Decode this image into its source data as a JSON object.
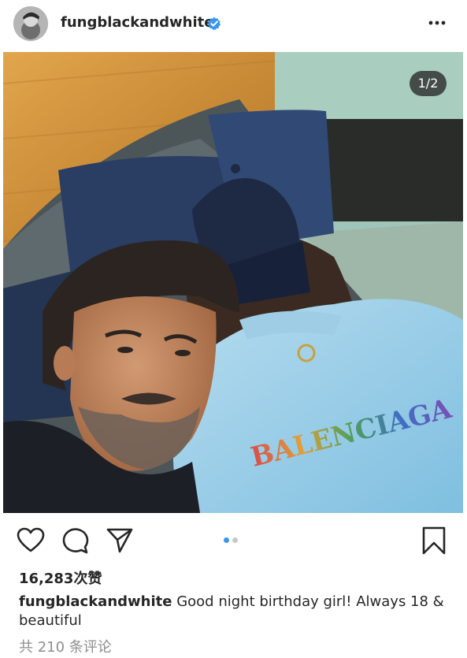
{
  "post": {
    "username": "fungblackandwhite",
    "verified": true,
    "photo_counter": "1/2",
    "carousel": {
      "count": 2,
      "active_index": 0
    },
    "likes_text": "16,283次赞",
    "caption_text": "Good night birthday girl! Always 18 & beautiful",
    "comments_text": "共 210 条评论",
    "hoodie_text": "BALENCIAGA"
  },
  "icons": {
    "verified": "verified-badge-icon",
    "more": "more-options-icon",
    "like": "heart-icon",
    "comment": "comment-icon",
    "share": "paper-plane-icon",
    "save": "bookmark-icon"
  },
  "colors": {
    "accent": "#3897f0",
    "text": "#262626",
    "secondary_text": "#8e8e8e"
  }
}
